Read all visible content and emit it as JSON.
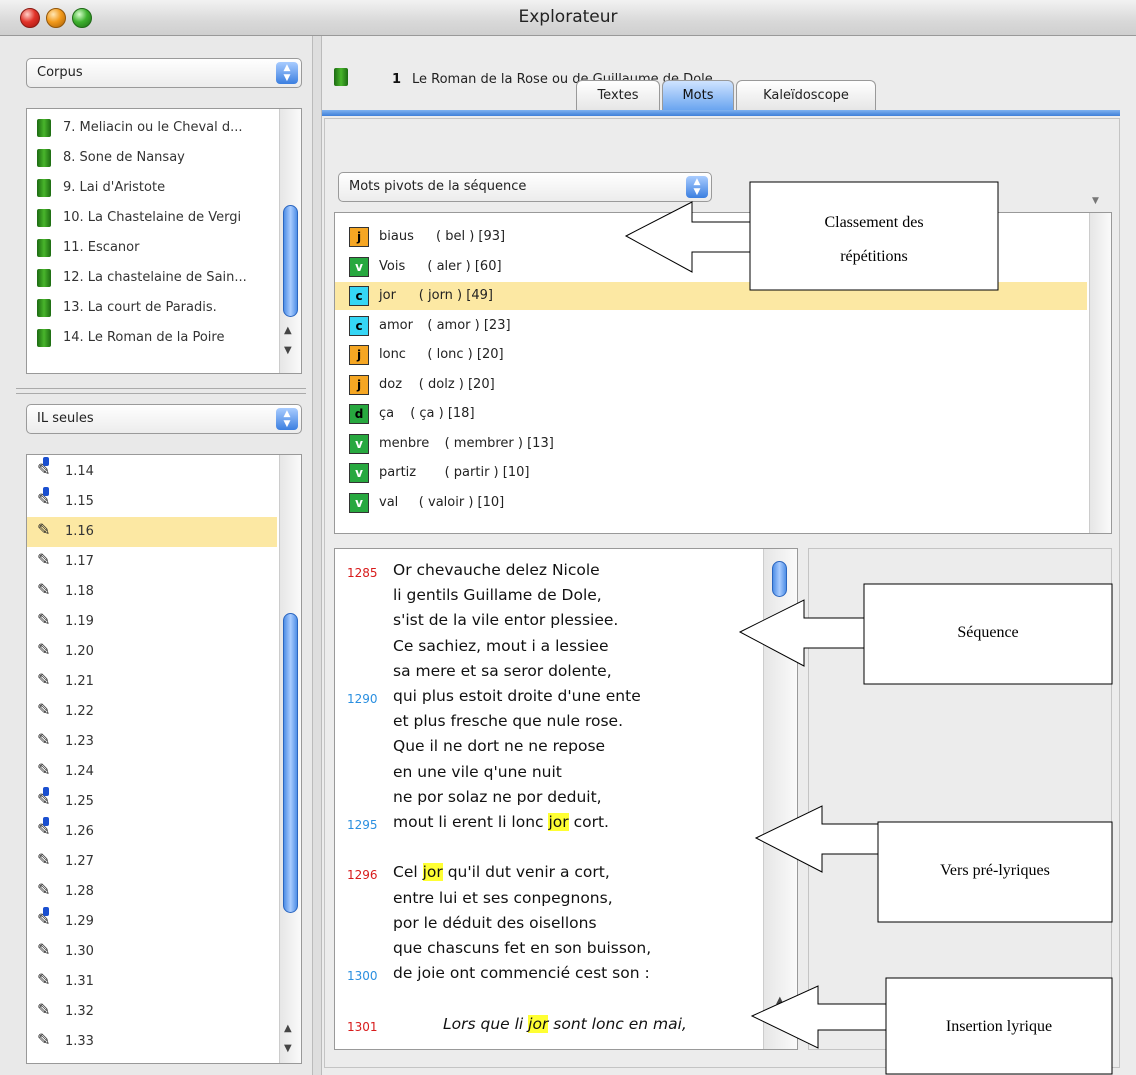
{
  "window": {
    "title": "Explorateur"
  },
  "left": {
    "corpus_popup": "Corpus",
    "corpus_items": [
      "7. Meliacin ou le Cheval d...",
      "8. Sone de Nansay",
      "9. Lai d'Aristote",
      "10. La Chastelaine de Vergi",
      "11. Escanor",
      "12. La chastelaine de Sain...",
      "13. La court de Paradis.",
      "14. Le Roman de la Poire"
    ],
    "filter_popup": "IL seules",
    "il_items": [
      {
        "label": "1.14",
        "marked": true
      },
      {
        "label": "1.15",
        "marked": true
      },
      {
        "label": "1.16",
        "marked": false,
        "selected": true
      },
      {
        "label": "1.17",
        "marked": false
      },
      {
        "label": "1.18",
        "marked": false
      },
      {
        "label": "1.19",
        "marked": false
      },
      {
        "label": "1.20",
        "marked": false
      },
      {
        "label": "1.21",
        "marked": false
      },
      {
        "label": "1.22",
        "marked": false
      },
      {
        "label": "1.23",
        "marked": false
      },
      {
        "label": "1.24",
        "marked": false
      },
      {
        "label": "1.25",
        "marked": true
      },
      {
        "label": "1.26",
        "marked": true
      },
      {
        "label": "1.27",
        "marked": false
      },
      {
        "label": "1.28",
        "marked": false
      },
      {
        "label": "1.29",
        "marked": true
      },
      {
        "label": "1.30",
        "marked": false
      },
      {
        "label": "1.31",
        "marked": false
      },
      {
        "label": "1.32",
        "marked": false
      },
      {
        "label": "1.33",
        "marked": false
      }
    ]
  },
  "right": {
    "text_number": "1",
    "text_title": "Le Roman de la Rose ou de Guillaume de Dole",
    "tabs": [
      "Textes",
      "Mots",
      "Kaleïdoscope"
    ],
    "active_tab": "Mots",
    "words_popup": "Mots pivots de la séquence",
    "words": [
      {
        "badge": "j",
        "word": "biaus",
        "lemma": "( bel ) [93]"
      },
      {
        "badge": "v",
        "word": "Vois",
        "lemma": "( aler ) [60]"
      },
      {
        "badge": "c",
        "word": "jor",
        "lemma": "( jorn ) [49]",
        "selected": true
      },
      {
        "badge": "c",
        "word": "amor",
        "lemma": "( amor ) [23]"
      },
      {
        "badge": "j",
        "word": "lonc",
        "lemma": "( lonc ) [20]"
      },
      {
        "badge": "j",
        "word": "doz",
        "lemma": "( dolz ) [20]"
      },
      {
        "badge": "d",
        "word": "ça",
        "lemma": "( ça ) [18]"
      },
      {
        "badge": "v",
        "word": "menbre",
        "lemma": "( membrer ) [13]"
      },
      {
        "badge": "v",
        "word": "partiz",
        "lemma": "( partir ) [10]"
      },
      {
        "badge": "v",
        "word": "val",
        "lemma": "( valoir ) [10]"
      }
    ],
    "verses": [
      {
        "num": "1285",
        "numColor": "#d81b1b",
        "parts": [
          "Or chevauche delez Nicole"
        ]
      },
      {
        "num": "",
        "parts": [
          "li gentils Guillame de Dole,"
        ]
      },
      {
        "num": "",
        "parts": [
          "s'ist de la vile entor plessiee."
        ]
      },
      {
        "num": "",
        "parts": [
          "Ce sachiez, mout i a lessiee"
        ]
      },
      {
        "num": "",
        "parts": [
          "sa mere et sa seror dolente,"
        ]
      },
      {
        "num": "1290",
        "numColor": "#2a8fe0",
        "parts": [
          "qui plus estoit droite d'une ente"
        ]
      },
      {
        "num": "",
        "parts": [
          "et plus fresche que nule rose."
        ]
      },
      {
        "num": "",
        "parts": [
          "Que il ne dort ne ne repose"
        ]
      },
      {
        "num": "",
        "parts": [
          "en une vile q'une nuit"
        ]
      },
      {
        "num": "",
        "parts": [
          "ne por solaz ne por deduit,"
        ]
      },
      {
        "num": "1295",
        "numColor": "#2a8fe0",
        "parts": [
          "mout li erent li lonc ",
          "jor",
          " cort."
        ]
      },
      {
        "num": "",
        "parts": [
          ""
        ]
      },
      {
        "num": "1296",
        "numColor": "#d81b1b",
        "parts": [
          "Cel ",
          "jor",
          " qu'il dut venir a cort,"
        ]
      },
      {
        "num": "",
        "parts": [
          "entre lui et ses conpegnons,"
        ]
      },
      {
        "num": "",
        "parts": [
          "por le déduit des oisellons"
        ]
      },
      {
        "num": "",
        "parts": [
          "que chascuns fet en son buisson,"
        ]
      },
      {
        "num": "1300",
        "numColor": "#2a8fe0",
        "parts": [
          "de joie ont commencié cest son :"
        ]
      },
      {
        "num": "",
        "parts": [
          ""
        ]
      },
      {
        "num": "1301",
        "numColor": "#d81b1b",
        "italic": true,
        "parts": [
          "Lors que li ",
          "jor",
          " sont lonc en mai,"
        ]
      }
    ]
  },
  "callouts": [
    {
      "label_lines": [
        "Classement des",
        "répétitions"
      ]
    },
    {
      "label_lines": [
        "Séquence"
      ]
    },
    {
      "label_lines": [
        "Vers pré-lyriques"
      ]
    },
    {
      "label_lines": [
        "Insertion lyrique"
      ]
    }
  ],
  "colors": {
    "highlight": "#ffff33",
    "selection": "#fce8a3",
    "red_num": "#d81b1b",
    "blue_num": "#2a8fe0",
    "accent": "#4f8fe6"
  }
}
